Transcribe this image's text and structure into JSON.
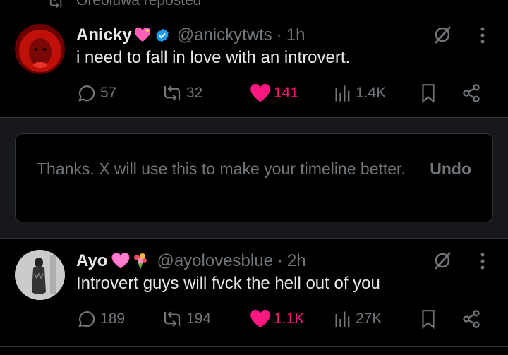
{
  "repost_banner": {
    "text": "Oreoluwa reposted"
  },
  "tweets": [
    {
      "name": "Anicky",
      "emojis": [
        "sparkling-heart",
        "blue-verified-badge"
      ],
      "handle": "@anickytwts",
      "time": "1h",
      "text": "i need to fall in love with an introvert.",
      "stats": {
        "replies": "57",
        "reposts": "32",
        "likes": "141",
        "views": "1.4K"
      },
      "liked": true
    },
    {
      "name": "Ayo",
      "emojis": [
        "pink-heart",
        "bouquet"
      ],
      "handle": "@ayolovesblue",
      "time": "2h",
      "text": "Introvert guys will fvck the hell out of you",
      "stats": {
        "replies": "189",
        "reposts": "194",
        "likes": "1.1K",
        "views": "27K"
      },
      "liked": true
    }
  ],
  "feedback": {
    "message": "Thanks. X will use this to make your timeline better.",
    "undo_label": "Undo"
  },
  "colors": {
    "background": "#000000",
    "text_primary": "#e7e9ea",
    "text_secondary": "#71767b",
    "like_active": "#f91880",
    "verified": "#1d9bf0",
    "feedback_band": "#16181c"
  }
}
